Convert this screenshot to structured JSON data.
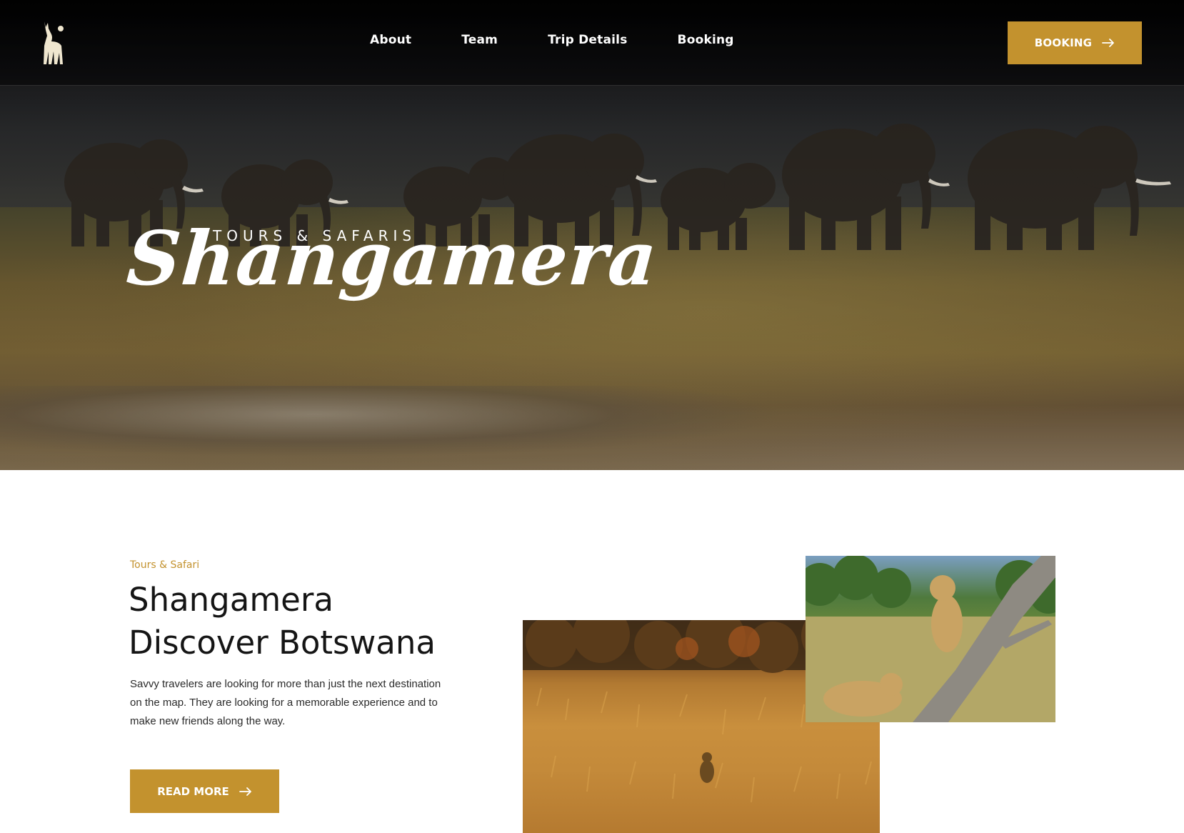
{
  "nav": {
    "links": [
      "About",
      "Team",
      "Trip Details",
      "Booking"
    ],
    "cta_label": "BOOKING",
    "logo_icon": "gazelle-logo-icon"
  },
  "hero": {
    "subtitle": "TOURS & SAFARIS",
    "title": "Shangamera"
  },
  "intro": {
    "eyebrow": "Tours & Safari",
    "heading_line1": "Shangamera",
    "heading_line2": "Discover Botswana",
    "paragraph": "Savvy travelers are looking for more than just the next destination on the map. They are looking for a memorable experience and to make new friends along the way.",
    "button_label": "READ MORE"
  },
  "colors": {
    "accent": "#c3922e",
    "nav_bg": "#0a0a0c",
    "text_dark": "#151515"
  },
  "icons": {
    "arrow": "arrow-right-icon"
  }
}
